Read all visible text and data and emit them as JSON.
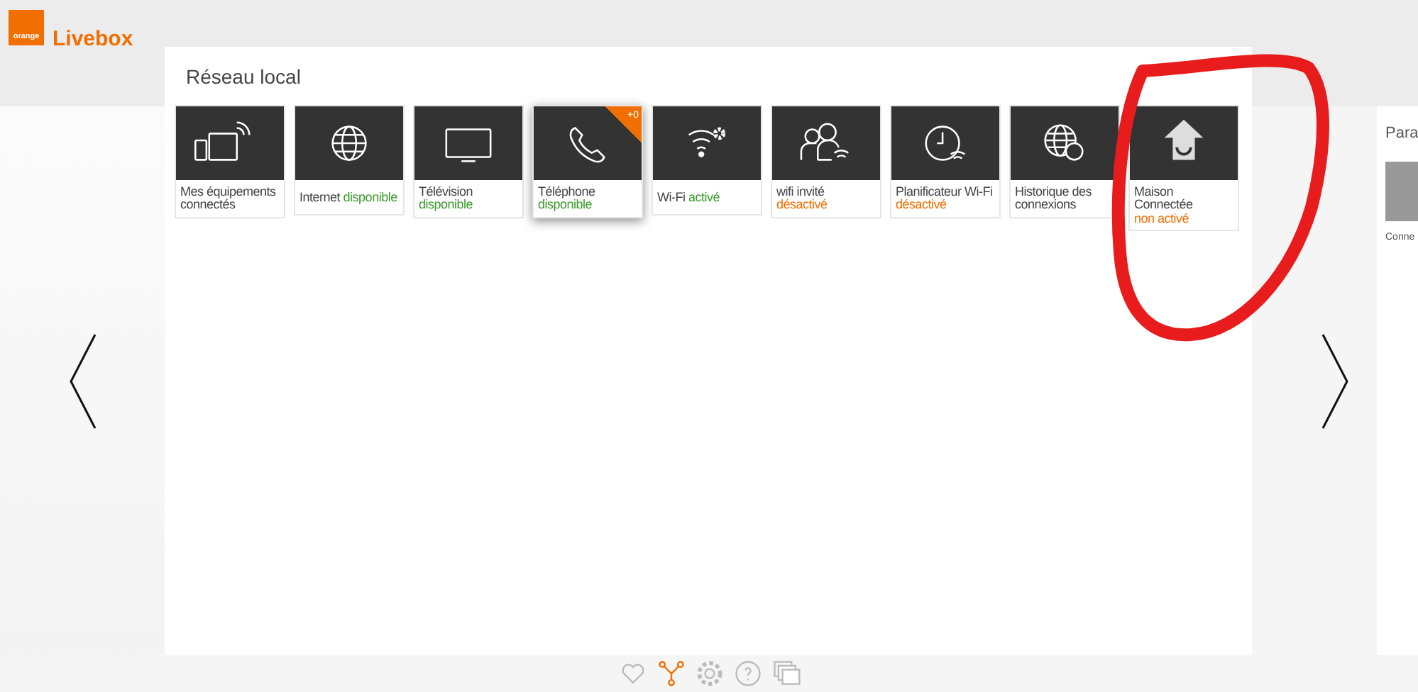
{
  "header": {
    "logo_text": "orange",
    "title": "Livebox"
  },
  "panel": {
    "title": "Réseau local",
    "tiles": [
      {
        "kind": "devices",
        "label": "Mes équipements connectés",
        "selected": false
      },
      {
        "kind": "internet",
        "label": "Internet",
        "status": {
          "text": "disponible",
          "active": true
        },
        "inline": true,
        "selected": false
      },
      {
        "kind": "tv",
        "label": "Télévision",
        "status": {
          "text": "disponible",
          "active": true
        },
        "selected": false
      },
      {
        "kind": "phone",
        "label": "Téléphone",
        "status": {
          "text": "disponible",
          "active": true
        },
        "badge": "+0",
        "selected": true
      },
      {
        "kind": "wifi",
        "label": "Wi-Fi",
        "status": {
          "text": "activé",
          "active": true
        },
        "inline": true,
        "selected": false
      },
      {
        "kind": "guest",
        "label": "wifi invité",
        "status": {
          "text": "désactivé",
          "active": false
        },
        "selected": false
      },
      {
        "kind": "scheduler",
        "label": "Planificateur Wi-Fi",
        "status": {
          "text": "désactivé",
          "active": false
        },
        "selected": false
      },
      {
        "kind": "history",
        "label": "Historique des connexions",
        "selected": false
      },
      {
        "kind": "home",
        "label": "Maison Connectée",
        "status": {
          "text": "non activé",
          "active": false
        },
        "selected": false
      }
    ]
  },
  "next_panel": {
    "title": "Para",
    "tile_label": "Conne"
  },
  "nav": [
    {
      "kind": "favorites",
      "selected": false
    },
    {
      "kind": "network",
      "selected": true
    },
    {
      "kind": "settings",
      "selected": false
    },
    {
      "kind": "help",
      "selected": false
    },
    {
      "kind": "windows",
      "selected": false
    }
  ]
}
